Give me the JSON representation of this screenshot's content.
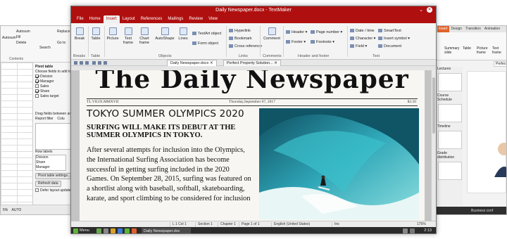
{
  "left_window": {
    "ribbon_items": [
      "Autosum",
      "Fill",
      "Delete",
      "Replace",
      "Go to",
      "Search",
      "Contents"
    ],
    "pivot": {
      "title": "Pivot table",
      "instruction": "Choose fields to add to r",
      "fields": [
        {
          "label": "Division",
          "checked": true
        },
        {
          "label": "Manager",
          "checked": true
        },
        {
          "label": "Sales",
          "checked": false
        },
        {
          "label": "Share",
          "checked": true
        },
        {
          "label": "Sales target",
          "checked": false
        }
      ],
      "drag_label": "Drag fields between areas",
      "report_filter": "Report filter",
      "col_label": "Colu",
      "row_labels_title": "Row labels",
      "row_labels": [
        "Division",
        "Share",
        "Manager"
      ],
      "settings_button": "Pivot table settings...",
      "refresh_button": "Refresh data",
      "defer_label": "Defer layout update"
    },
    "status": {
      "zoom": "5%",
      "mode": "AUTO"
    }
  },
  "main_window": {
    "title": "Daily Newspaper.docx - TextMaker",
    "menu": [
      "File",
      "Home",
      "Insert",
      "Layout",
      "References",
      "Mailings",
      "Review",
      "View"
    ],
    "active_menu": "Insert",
    "ribbon": {
      "buttons": [
        "Break",
        "Table",
        "Picture",
        "Text frame",
        "Chart frame",
        "AutoShape",
        "Lines",
        "Comment"
      ],
      "small_items": [
        "TextArt object",
        "Form object",
        "Hyperlink",
        "Bookmark",
        "Cross reference",
        "Header",
        "Footer",
        "Page number",
        "Footnote",
        "Date / time",
        "Character",
        "Field",
        "SmartText",
        "Insert symbol",
        "Document"
      ],
      "groups": [
        "Breaks",
        "Table",
        "Objects",
        "Links",
        "Comments",
        "Header and footer",
        "Text"
      ]
    },
    "doc_tabs": [
      "Daily Newspaper.docx",
      "Perfect Property Solution..."
    ],
    "newspaper": {
      "masthead": "The Daily Newspaper",
      "issue": "TL VII.IX.MMXVII",
      "date": "Thursday,September 07, 2017",
      "price": "$2.50",
      "headline": "TOKYO SUMMER OLYMPICS 2020",
      "subheadline": "SURFING WILL MAKE ITS DEBUT AT THE SUMMER OLYMPICS IN TOKYO.",
      "body": "After several attempts for inclusion into the Olympics, the International Surfing Association has become successful in getting surfing included in the 2020 Games. On September 28, 2015, surfing was featured on a shortlist along with baseball, softball, skateboarding, karate, and sport climbing to be considered for inclusion"
    },
    "statusbar": {
      "position": "L 1 Col 1",
      "section": "Section 1",
      "chapter": "Chapter 1",
      "page": "Page 1 of 1",
      "language": "English (United States)",
      "mode": "Ins",
      "zoom": "175%"
    },
    "taskbar": {
      "menu": "Menu",
      "task": "Daily Newspaper.doc",
      "clock": "2:13"
    }
  },
  "right_window": {
    "tabs": [
      "Insert",
      "Design",
      "Transition",
      "Animation"
    ],
    "active_tab": "Insert",
    "ribbon_items": [
      "Summary slide",
      "Table",
      "Picture frame",
      "Text frame"
    ],
    "thumbnail_labels": [
      "Lectures",
      "Course Schedule",
      "Timeline",
      "Grade distribution"
    ],
    "perfect_label": "Perfect",
    "taskbar_label": "Business conf"
  }
}
